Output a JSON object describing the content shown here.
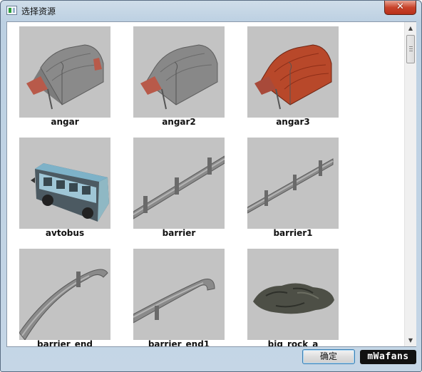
{
  "window": {
    "title": "选择资源",
    "close_glyph": "✕"
  },
  "assets": [
    {
      "name": "angar",
      "icon": "hangar-grey"
    },
    {
      "name": "angar2",
      "icon": "hangar-grey"
    },
    {
      "name": "angar3",
      "icon": "hangar-red"
    },
    {
      "name": "avtobus",
      "icon": "bus"
    },
    {
      "name": "barrier",
      "icon": "guardrail"
    },
    {
      "name": "barrier1",
      "icon": "guardrail"
    },
    {
      "name": "barrier_end",
      "icon": "guardrail-curved"
    },
    {
      "name": "barrier_end1",
      "icon": "guardrail-curved"
    },
    {
      "name": "big_rock_a",
      "icon": "rock"
    }
  ],
  "footer": {
    "ok_label": "确定",
    "watermark": "mWafans"
  },
  "colors": {
    "thumb_bg": "#c3c3c3",
    "hangar_red": "#b8482a",
    "close_red": "#c8432b"
  }
}
